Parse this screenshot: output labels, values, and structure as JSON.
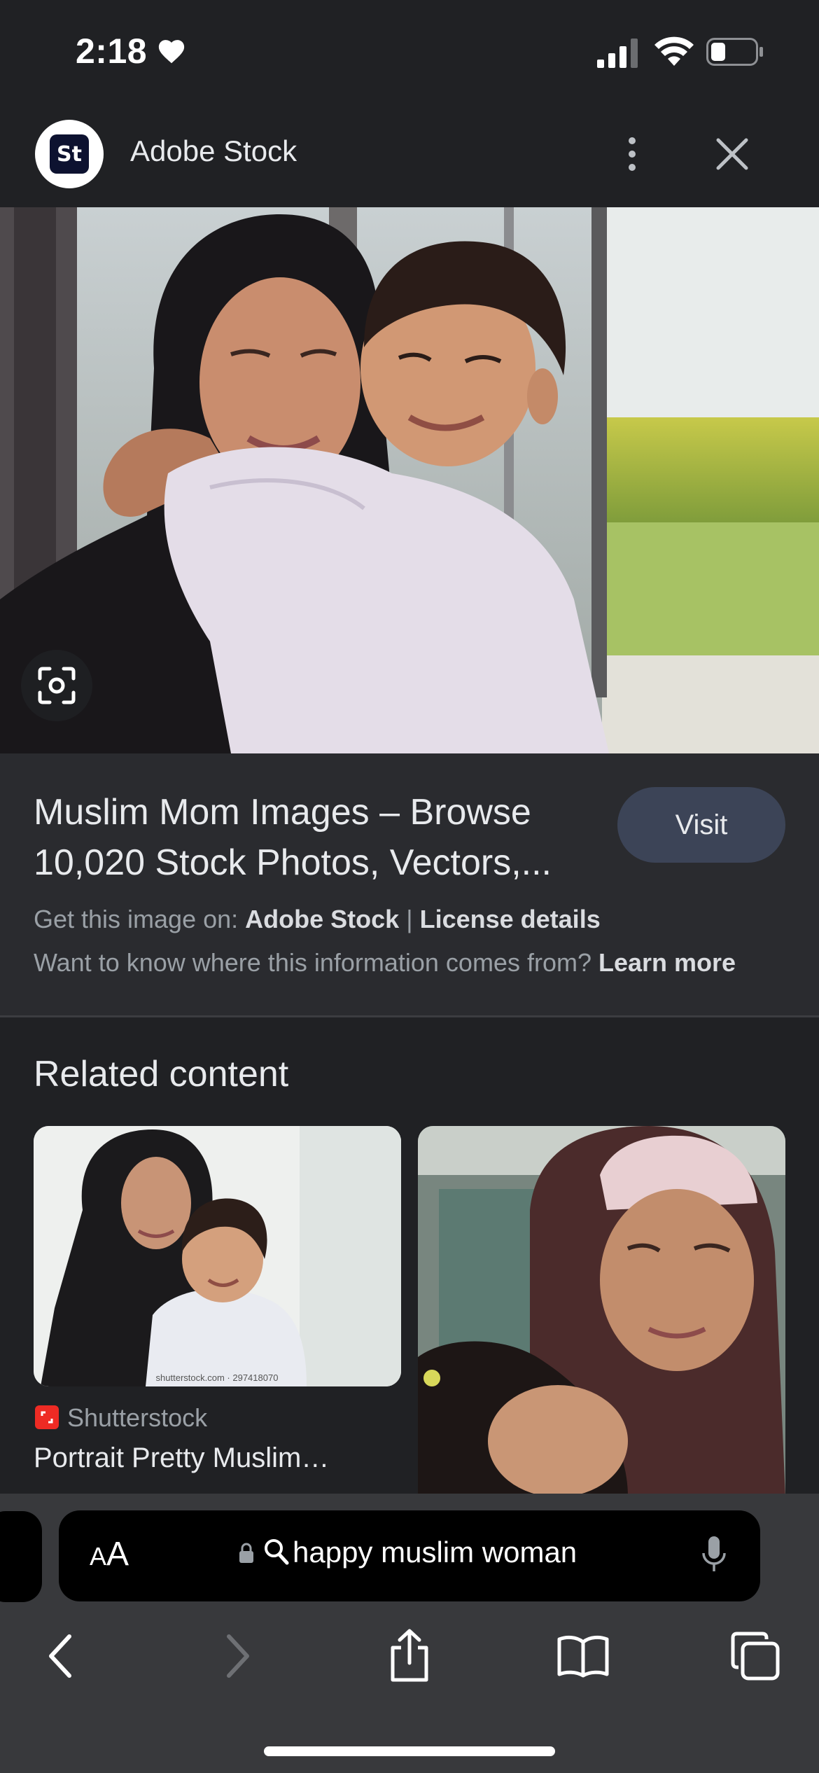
{
  "status_bar": {
    "time": "2:18",
    "icons": [
      "heart-icon",
      "signal-icon",
      "wifi-icon",
      "battery-icon"
    ]
  },
  "site_header": {
    "logo_text": "St",
    "site_name": "Adobe Stock",
    "icons": [
      "more-vert-icon",
      "close-icon"
    ]
  },
  "image_result": {
    "title": "Muslim Mom Images – Browse 10,020 Stock Photos, Vectors,...",
    "visit_label": "Visit",
    "source_prefix": "Get this image on:",
    "source_name": "Adobe Stock",
    "separator": "|",
    "license_label": "License details",
    "info_question": "Want to know where this information comes from?",
    "learn_more_label": "Learn more"
  },
  "related": {
    "heading": "Related content",
    "cards": [
      {
        "source": "Shutterstock",
        "title": "Portrait Pretty Muslim…",
        "watermark": "shutterstock.com · 297418070"
      },
      {
        "source": "",
        "title": ""
      }
    ]
  },
  "browser": {
    "text_size_small": "A",
    "text_size_large": "A",
    "address_text": "happy muslim woman",
    "nav_icons": [
      "back-icon",
      "forward-icon",
      "share-icon",
      "bookmarks-icon",
      "tabs-icon"
    ]
  },
  "colors": {
    "background": "#202124",
    "info_panel": "#2a2b2f",
    "visit_button": "#3c4457",
    "toolbar": "#38393c"
  }
}
